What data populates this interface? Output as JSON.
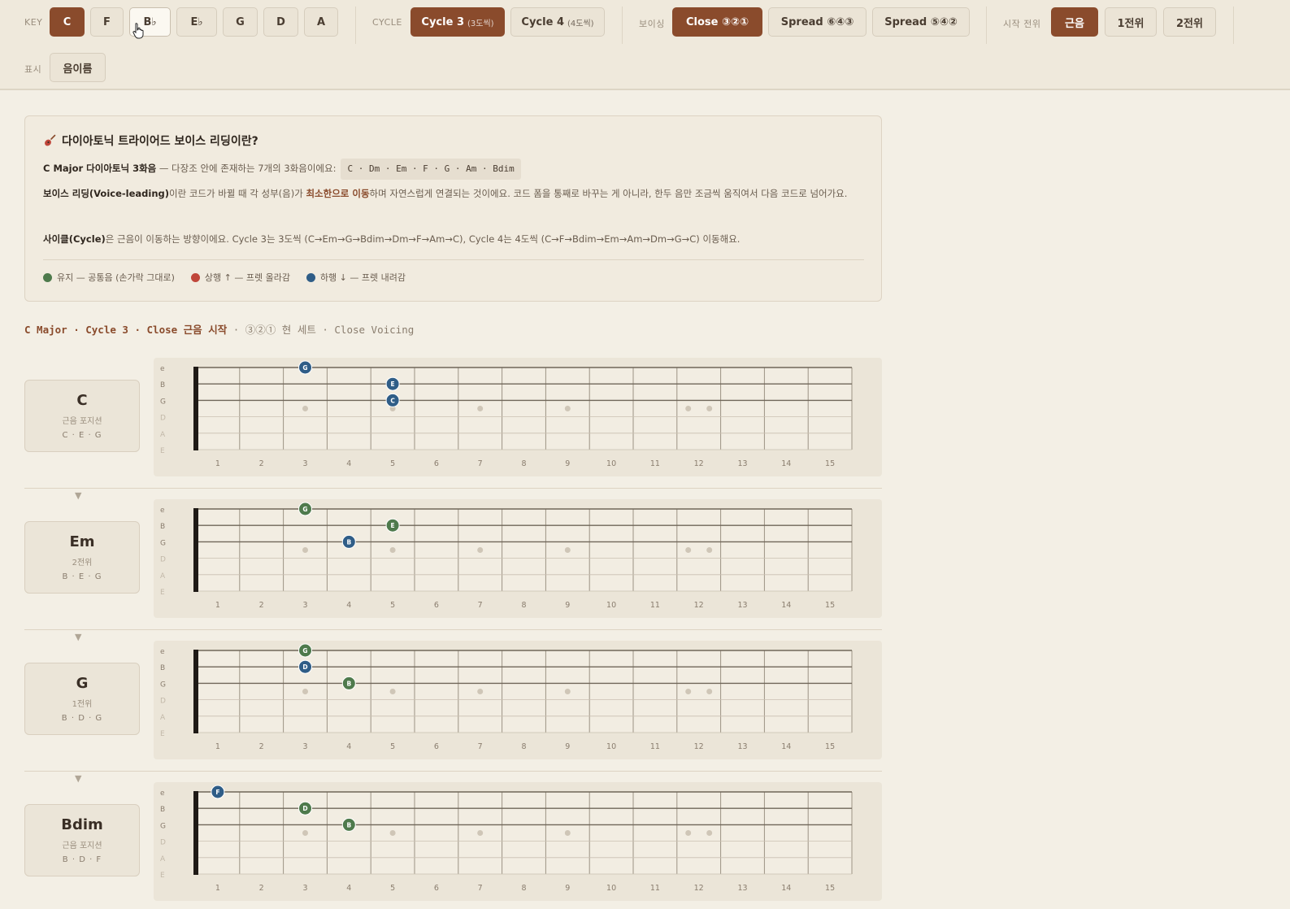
{
  "toolbar": {
    "key_label": "KEY",
    "keys": [
      {
        "label": "C",
        "state": "active"
      },
      {
        "label": "F",
        "state": ""
      },
      {
        "label": "B♭",
        "state": "hover"
      },
      {
        "label": "E♭",
        "state": ""
      },
      {
        "label": "G",
        "state": ""
      },
      {
        "label": "D",
        "state": ""
      },
      {
        "label": "A",
        "state": ""
      }
    ],
    "cycle_label": "CYCLE",
    "cycles": [
      {
        "label": "Cycle 3",
        "sub": "(3도씩)",
        "state": "active"
      },
      {
        "label": "Cycle 4",
        "sub": "(4도씩)",
        "state": ""
      }
    ],
    "voicing_label": "보이싱",
    "voicings": [
      {
        "label": "Close ③②①",
        "state": "active"
      },
      {
        "label": "Spread ⑥④③",
        "state": ""
      },
      {
        "label": "Spread ⑤④②",
        "state": ""
      }
    ],
    "start_label": "시작 전위",
    "starts": [
      {
        "label": "근음",
        "state": "active"
      },
      {
        "label": "1전위",
        "state": ""
      },
      {
        "label": "2전위",
        "state": ""
      }
    ],
    "display_label": "표시",
    "display_button": "음이름"
  },
  "info": {
    "title": "다이아토닉 트라이어드 보이스 리딩이란?",
    "line1_bold": "C Major 다이아토닉 3화음",
    "line1_text": " — 다장조 안에 존재하는 7개의 3화음이에요:",
    "line1_chip": "C · Dm · Em · F · G · Am · Bdim",
    "line2_bold": "보이스 리딩(Voice-leading)",
    "line2_text_a": "이란 코드가 바뀔 때 각 성부(음)가 ",
    "line2_highlight": "최소한으로 이동",
    "line2_text_b": "하며 자연스럽게 연결되는 것이에요. 코드 폼을 통째로 바꾸는 게 아니라, 한두 음만 조금씩 움직여서 다음 코드로 넘어가요.",
    "line3_bold": "사이클(Cycle)",
    "line3_text": "은 근음이 이동하는 방향이에요. Cycle 3는 3도씩 (C→Em→G→Bdim→Dm→F→Am→C), Cycle 4는 4도씩 (C→F→Bdim→Em→Am→Dm→G→C) 이동해요.",
    "legend": [
      {
        "label": "유지 — 공통음 (손가락 그대로)",
        "color": "#4e7a4c"
      },
      {
        "label": "상행 ↑ — 프렛 올라감",
        "color": "#c0463a"
      },
      {
        "label": "하행 ↓ — 프렛 내려감",
        "color": "#2f5d87"
      }
    ]
  },
  "subtitle": {
    "strong": "C Major · Cycle 3 · Close 근음 시작",
    "rest": " · ③②① 현 세트 · Close Voicing"
  },
  "fretboard": {
    "string_names": [
      "e",
      "B",
      "G",
      "D",
      "A",
      "E"
    ],
    "fret_numbers": [
      "1",
      "2",
      "3",
      "4",
      "5",
      "6",
      "7",
      "8",
      "9",
      "10",
      "11",
      "12",
      "13",
      "14",
      "15"
    ],
    "inlay_frets": [
      3,
      5,
      7,
      9
    ],
    "double_inlay_fret": 12
  },
  "chords": [
    {
      "name": "C",
      "position": "근음 포지션",
      "notes": "C · E · G",
      "dots": [
        {
          "string": 0,
          "fret": 3,
          "note": "G",
          "move": "down"
        },
        {
          "string": 1,
          "fret": 5,
          "note": "E",
          "move": "down"
        },
        {
          "string": 2,
          "fret": 5,
          "note": "C",
          "move": "down"
        }
      ]
    },
    {
      "name": "Em",
      "position": "2전위",
      "notes": "B · E · G",
      "dots": [
        {
          "string": 0,
          "fret": 3,
          "note": "G",
          "move": "keep"
        },
        {
          "string": 1,
          "fret": 5,
          "note": "E",
          "move": "keep"
        },
        {
          "string": 2,
          "fret": 4,
          "note": "B",
          "move": "down"
        }
      ]
    },
    {
      "name": "G",
      "position": "1전위",
      "notes": "B · D · G",
      "dots": [
        {
          "string": 0,
          "fret": 3,
          "note": "G",
          "move": "keep"
        },
        {
          "string": 1,
          "fret": 3,
          "note": "D",
          "move": "down"
        },
        {
          "string": 2,
          "fret": 4,
          "note": "B",
          "move": "keep"
        }
      ]
    },
    {
      "name": "Bdim",
      "position": "근음 포지션",
      "notes": "B · D · F",
      "dots": [
        {
          "string": 0,
          "fret": 1,
          "note": "F",
          "move": "down"
        },
        {
          "string": 1,
          "fret": 3,
          "note": "D",
          "move": "keep"
        },
        {
          "string": 2,
          "fret": 4,
          "note": "B",
          "move": "keep"
        }
      ]
    }
  ],
  "colors": {
    "keep": "#4e7a4c",
    "up": "#c0463a",
    "down": "#2f5d87",
    "accent": "#8a4b2c"
  }
}
